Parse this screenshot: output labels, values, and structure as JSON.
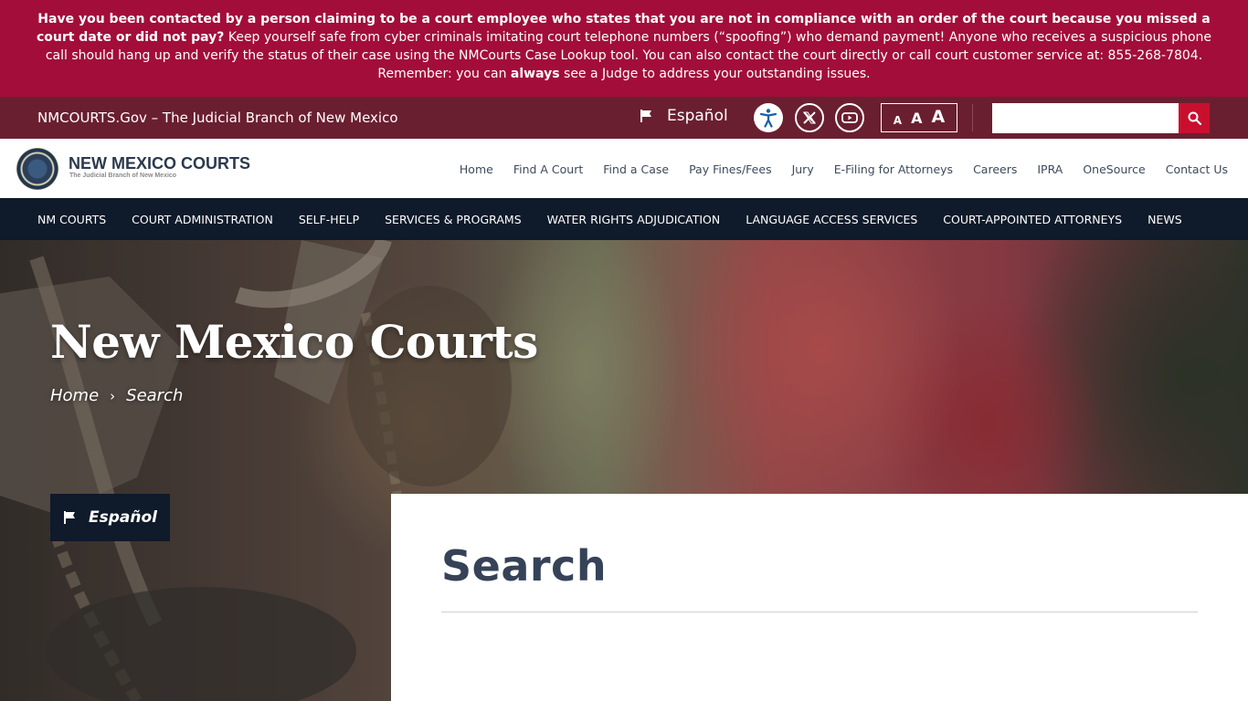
{
  "alert": {
    "bold_intro": "Have you been contacted by a person claiming to be a court employee who states that you are not in compliance with an order of the court because you missed a court date or did not pay?",
    "text_1": " Keep yourself safe from cyber criminals imitating court telephone numbers (“spoofing”) who demand payment!  Anyone who receives a suspicious phone call should hang up and verify the status of their case using the NMCourts Case Lookup tool.  You can also contact the court directly or call court customer service at: 855-268-7804.  Remember: you can ",
    "bold_always": "always",
    "text_2": " see a Judge to address your outstanding issues."
  },
  "utility": {
    "site_title": "NMCOURTS.Gov – The Judicial Branch of New Mexico",
    "espanol": "Español",
    "font_small": "A",
    "font_medium": "A",
    "font_large": "A",
    "search_placeholder": ""
  },
  "header": {
    "logo_title": "NEW MEXICO COURTS",
    "logo_subtitle": "The Judicial Branch of New Mexico",
    "topnav": [
      "Home",
      "Find A Court",
      "Find a Case",
      "Pay Fines/Fees",
      "Jury",
      "E-Filing for Attorneys",
      "Careers",
      "IPRA",
      "OneSource",
      "Contact Us"
    ]
  },
  "mainnav": [
    "NM COURTS",
    "COURT ADMINISTRATION",
    "SELF-HELP",
    "SERVICES & PROGRAMS",
    "WATER RIGHTS ADJUDICATION",
    "LANGUAGE ACCESS SERVICES",
    "COURT-APPOINTED ATTORNEYS",
    "NEWS"
  ],
  "hero": {
    "title": "New Mexico Courts",
    "breadcrumb": [
      "Home",
      "Search"
    ],
    "breadcrumb_sep": "›",
    "espanol_badge": "Español"
  },
  "content": {
    "heading": "Search"
  },
  "colors": {
    "alert_bg": "#a30d3a",
    "utility_bg": "#6a1f30",
    "nav_bg": "#0f1a2a",
    "search_btn": "#c8102e",
    "heading": "#364257"
  }
}
